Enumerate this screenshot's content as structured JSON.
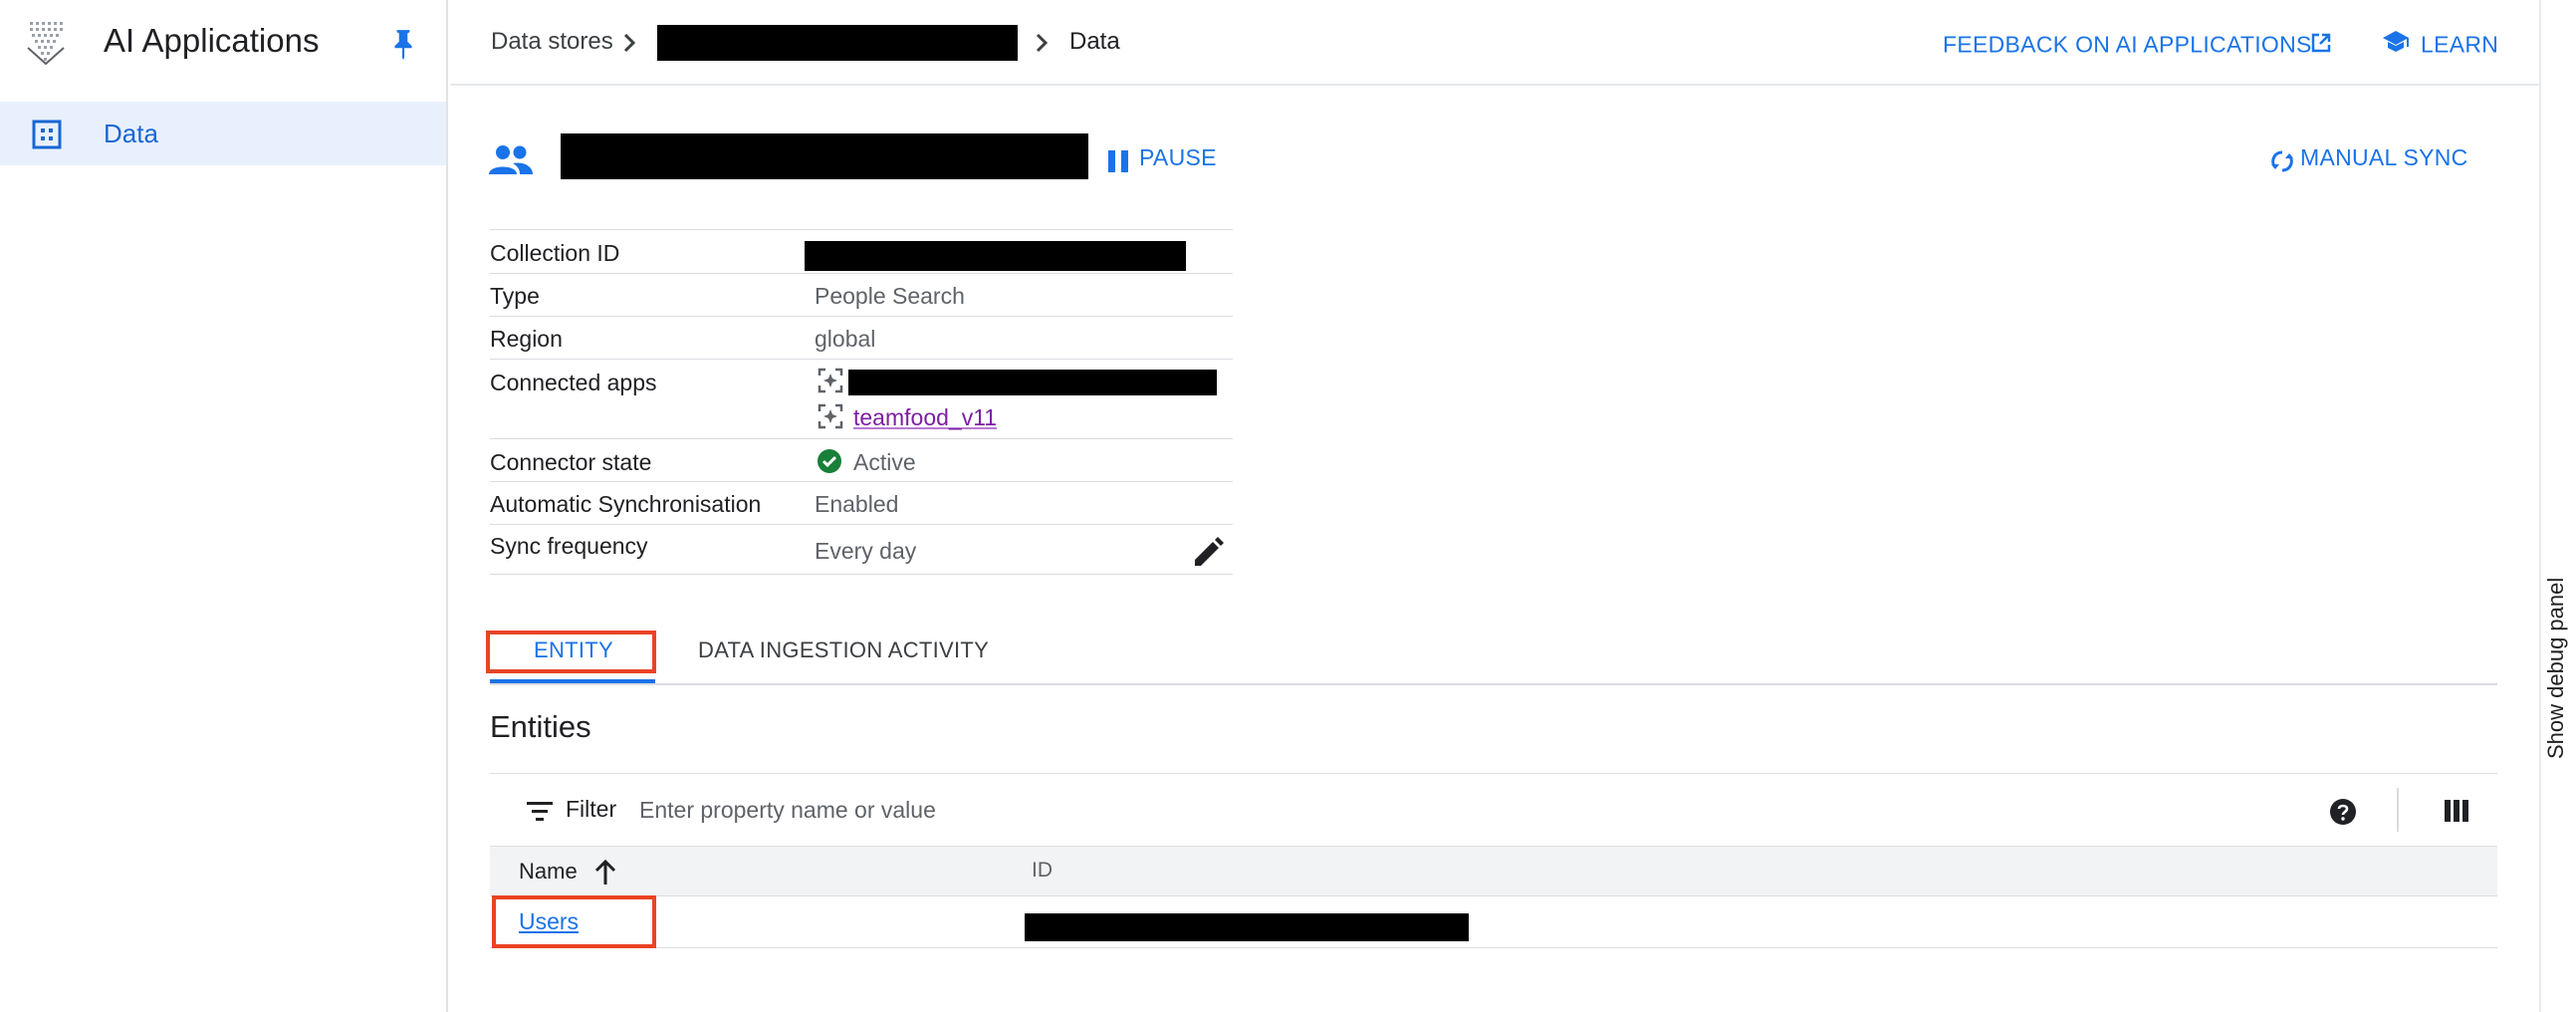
{
  "app": {
    "title": "AI Applications"
  },
  "sidebar": {
    "items": [
      {
        "label": "Data",
        "icon": "grid-icon",
        "active": true
      }
    ]
  },
  "breadcrumb": {
    "items": [
      "Data stores",
      "Data"
    ]
  },
  "header_links": {
    "feedback": "FEEDBACK ON AI APPLICATIONS",
    "learn": "LEARN"
  },
  "datastore": {
    "pause_label": "PAUSE",
    "manual_sync_label": "MANUAL SYNC"
  },
  "details": {
    "rows": [
      {
        "label": "Collection ID",
        "value": ""
      },
      {
        "label": "Type",
        "value": "People Search"
      },
      {
        "label": "Region",
        "value": "global"
      },
      {
        "label": "Connected apps",
        "value": "",
        "apps": [
          "",
          "teamfood_v11"
        ]
      },
      {
        "label": "Connector state",
        "value": "Active"
      },
      {
        "label": "Automatic Synchronisation",
        "value": "Enabled"
      },
      {
        "label": "Sync frequency",
        "value": "Every day"
      }
    ]
  },
  "tabs": [
    {
      "label": "ENTITY",
      "active": true
    },
    {
      "label": "DATA INGESTION ACTIVITY",
      "active": false
    }
  ],
  "entities": {
    "title": "Entities",
    "filter_label": "Filter",
    "filter_placeholder": "Enter property name or value",
    "columns": [
      "Name",
      "ID"
    ],
    "rows": [
      {
        "name": "Users",
        "id": ""
      }
    ]
  },
  "debug_panel": {
    "label": "Show debug panel"
  },
  "colors": {
    "accent": "#1a73e8",
    "nav_active_bg": "#e8f0fe",
    "success": "#188038",
    "highlight": "#ea4324",
    "link_visited": "#7b1fa2"
  }
}
